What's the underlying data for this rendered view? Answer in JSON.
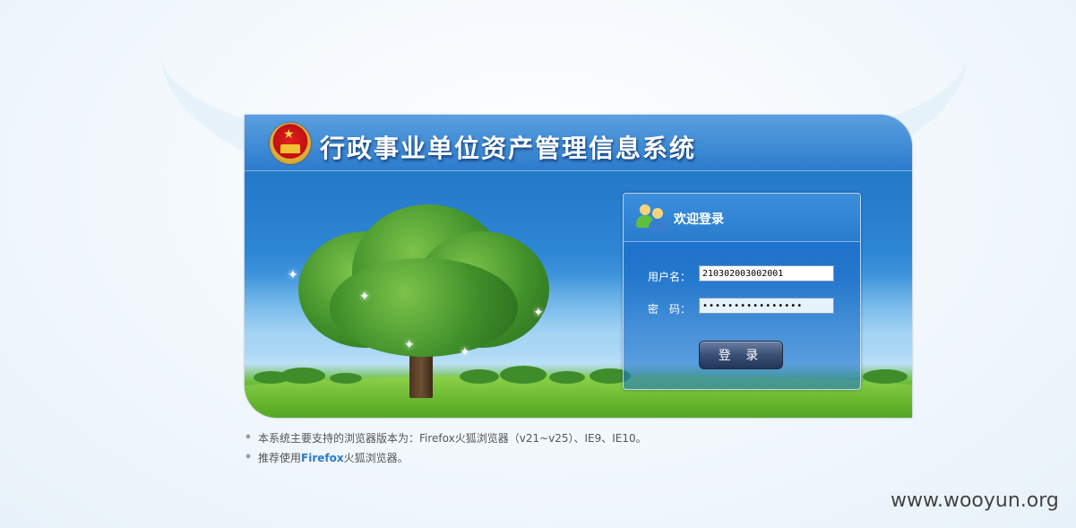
{
  "header": {
    "title": "行政事业单位资产管理信息系统",
    "emblem_icon": "national-emblem-icon"
  },
  "login": {
    "title": "欢迎登录",
    "username_label": "用户名：",
    "username_value": "210302003002001",
    "password_label": "密　码：",
    "password_mask": "••••••••••••••••",
    "submit_label": "登 录"
  },
  "notes": {
    "line1": "本系统主要支持的浏览器版本为：Firefox火狐浏览器（v21~v25）、IE9、IE10。",
    "line2_prefix": "推荐使用",
    "line2_highlight": "Firefox",
    "line2_suffix": "火狐浏览器。",
    "bullet": "*"
  },
  "watermark": "www.wooyun.org",
  "colors": {
    "panel_blue": "#1e6fc0",
    "button_dark": "#22365a",
    "link_blue": "#2a7cc8",
    "grass_green": "#5fb128"
  }
}
